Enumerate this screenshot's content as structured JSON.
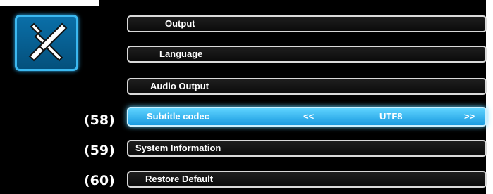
{
  "menu": {
    "items": [
      {
        "label": "Output"
      },
      {
        "label": "Language"
      },
      {
        "label": "Audio Output"
      },
      {
        "label": "Subtitle codec",
        "value": "UTF8",
        "prev": "<<",
        "next": ">>"
      },
      {
        "label": "System Information"
      },
      {
        "label": "Restore Default"
      }
    ]
  },
  "annotations": [
    "(58)",
    "(59)",
    "(60)"
  ],
  "icons": {
    "tools": "tools-icon"
  },
  "colors": {
    "accent": "#1a9be0",
    "background": "#000000"
  }
}
